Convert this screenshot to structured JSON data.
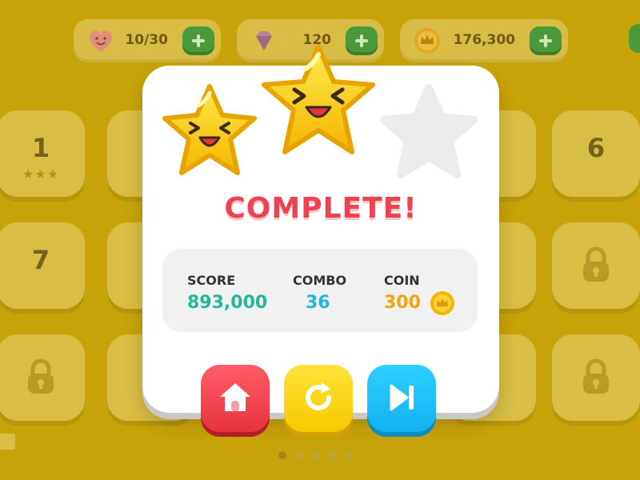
{
  "resources": {
    "hearts": {
      "icon": "heart-face-icon",
      "value": "10/30"
    },
    "gems": {
      "icon": "gem-icon",
      "value": "120"
    },
    "coins": {
      "icon": "crown-coin-icon",
      "value": "176,300"
    }
  },
  "levels": [
    {
      "number": "1",
      "stars": "★★★"
    },
    {
      "number": "6"
    },
    {
      "number": "7"
    }
  ],
  "result": {
    "title": "COMPLETE!",
    "stars_earned": 2,
    "stars_total": 3,
    "score_label": "SCORE",
    "score_value": "893,000",
    "combo_label": "COMBO",
    "combo_value": "36",
    "coin_label": "COIN",
    "coin_value": "300"
  },
  "colors": {
    "title": "#ef4250",
    "score": "#24b79a",
    "combo": "#1fb8d8",
    "coin": "#f2a50c",
    "home_button": "#e7333f",
    "replay_button": "#f8c800",
    "next_button": "#12b1f2"
  },
  "buttons": {
    "home": "home-icon",
    "replay": "replay-icon",
    "next": "skip-next-icon"
  },
  "pagination": {
    "pages": 5,
    "current": 1
  }
}
